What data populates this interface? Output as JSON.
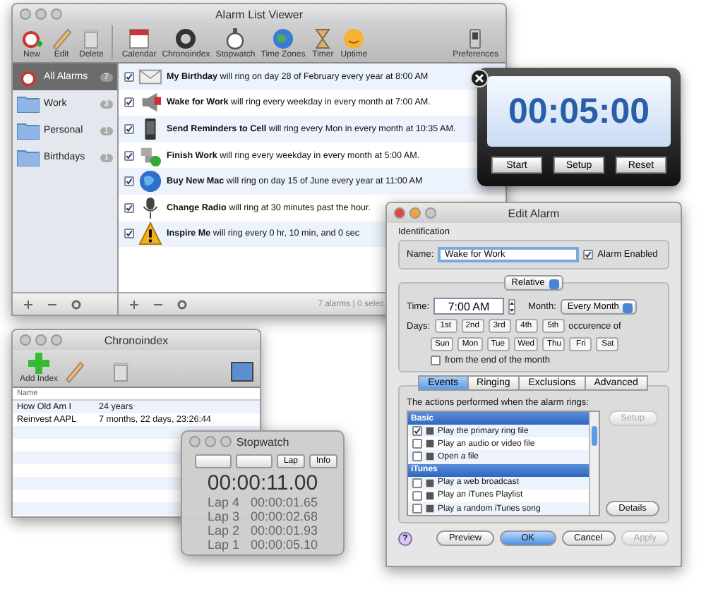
{
  "alarm_list": {
    "title": "Alarm List Viewer",
    "toolbar": [
      {
        "label": "New"
      },
      {
        "label": "Edit"
      },
      {
        "label": "Delete"
      },
      {
        "label": "Calendar"
      },
      {
        "label": "Chronoindex"
      },
      {
        "label": "Stopwatch"
      },
      {
        "label": "Time Zones"
      },
      {
        "label": "Timer"
      },
      {
        "label": "Uptime"
      },
      {
        "label": "Preferences"
      }
    ],
    "sidebar": [
      {
        "label": "All Alarms",
        "count": "7",
        "selected": true
      },
      {
        "label": "Work",
        "count": "3",
        "selected": false
      },
      {
        "label": "Personal",
        "count": "1",
        "selected": false
      },
      {
        "label": "Birthdays",
        "count": "1",
        "selected": false
      }
    ],
    "alarms": [
      {
        "text": "**My Birthday** will ring on day 28 of February every year at 8:00 AM",
        "enabled": true
      },
      {
        "text": "**Wake for Work** will ring every weekday in every month at 7:00 AM.",
        "enabled": true
      },
      {
        "text": "**Send Reminders to Cell** will ring every Mon in every month at 10:35 AM.",
        "enabled": true
      },
      {
        "text": "**Finish Work** will ring every weekday in every month at 5:00 AM.",
        "enabled": true
      },
      {
        "text": "**Buy New Mac** will ring on day 15 of June every year at 11:00 AM",
        "enabled": true
      },
      {
        "text": "**Change Radio** will ring at 30 minutes past the hour.",
        "enabled": true
      },
      {
        "text": "**Inspire Me** will ring every 0 hr, 10 min, and 0 sec",
        "enabled": true
      }
    ],
    "status": "7 alarms | 0 selec"
  },
  "timer": {
    "time": "00:05:00",
    "buttons": [
      "Start",
      "Setup",
      "Reset"
    ]
  },
  "edit_alarm": {
    "title": "Edit Alarm",
    "section": "Identification",
    "name_label": "Name:",
    "name_value": "Wake for Work",
    "enabled_label": "Alarm Enabled",
    "alarm_enabled": true,
    "mode": "Relative",
    "time_label": "Time:",
    "time_value": "7:00 AM",
    "month_label": "Month:",
    "month_value": "Every Month",
    "days_label": "Days:",
    "ordinals": [
      "1st",
      "2nd",
      "3rd",
      "4th",
      "5th"
    ],
    "occurrence_text": "occurence of",
    "weekdays": [
      "Sun",
      "Mon",
      "Tue",
      "Wed",
      "Thu",
      "Fri",
      "Sat"
    ],
    "from_end_label": "from the end of the month",
    "from_end": false,
    "tabs": [
      {
        "label": "Events",
        "selected": true
      },
      {
        "label": "Ringing",
        "selected": false
      },
      {
        "label": "Exclusions",
        "selected": false
      },
      {
        "label": "Advanced",
        "selected": false
      }
    ],
    "actions_caption": "The actions performed when the alarm rings:",
    "groups": [
      {
        "name": "Basic",
        "items": [
          {
            "label": "Play the primary ring file",
            "checked": true
          },
          {
            "label": "Play an audio or video file",
            "checked": false
          },
          {
            "label": "Open a file",
            "checked": false
          }
        ]
      },
      {
        "name": "iTunes",
        "items": [
          {
            "label": "Play a web broadcast",
            "checked": false
          },
          {
            "label": "Play an iTunes Playlist",
            "checked": false
          },
          {
            "label": "Play a random iTunes song",
            "checked": false
          }
        ]
      }
    ],
    "setup": {
      "label": "Setup",
      "disabled": true
    },
    "details": {
      "label": "Details",
      "disabled": false
    },
    "help": "?",
    "buttons": [
      {
        "label": "Preview",
        "kind": "normal",
        "disabled": false
      },
      {
        "label": "OK",
        "kind": "default",
        "disabled": false
      },
      {
        "label": "Cancel",
        "kind": "normal",
        "disabled": false
      },
      {
        "label": "Apply",
        "kind": "normal",
        "disabled": true
      }
    ]
  },
  "chronoindex": {
    "title": "Chronoindex",
    "toolbar": [
      "Add Index"
    ],
    "column": "Name",
    "rows": [
      {
        "name": "How Old Am I",
        "value": "24 years"
      },
      {
        "name": "Reinvest AAPL",
        "value": "7 months, 22 days, 23:26:44"
      }
    ]
  },
  "stopwatch": {
    "title": "Stopwatch",
    "buttons": [
      "Lap",
      "Info"
    ],
    "time": "00:00:11.00",
    "laps": [
      {
        "label": "Lap 4",
        "time": "00:00:01.65"
      },
      {
        "label": "Lap 3",
        "time": "00:00:02.68"
      },
      {
        "label": "Lap 2",
        "time": "00:00:01.93"
      },
      {
        "label": "Lap 1",
        "time": "00:00:05.10"
      }
    ]
  }
}
